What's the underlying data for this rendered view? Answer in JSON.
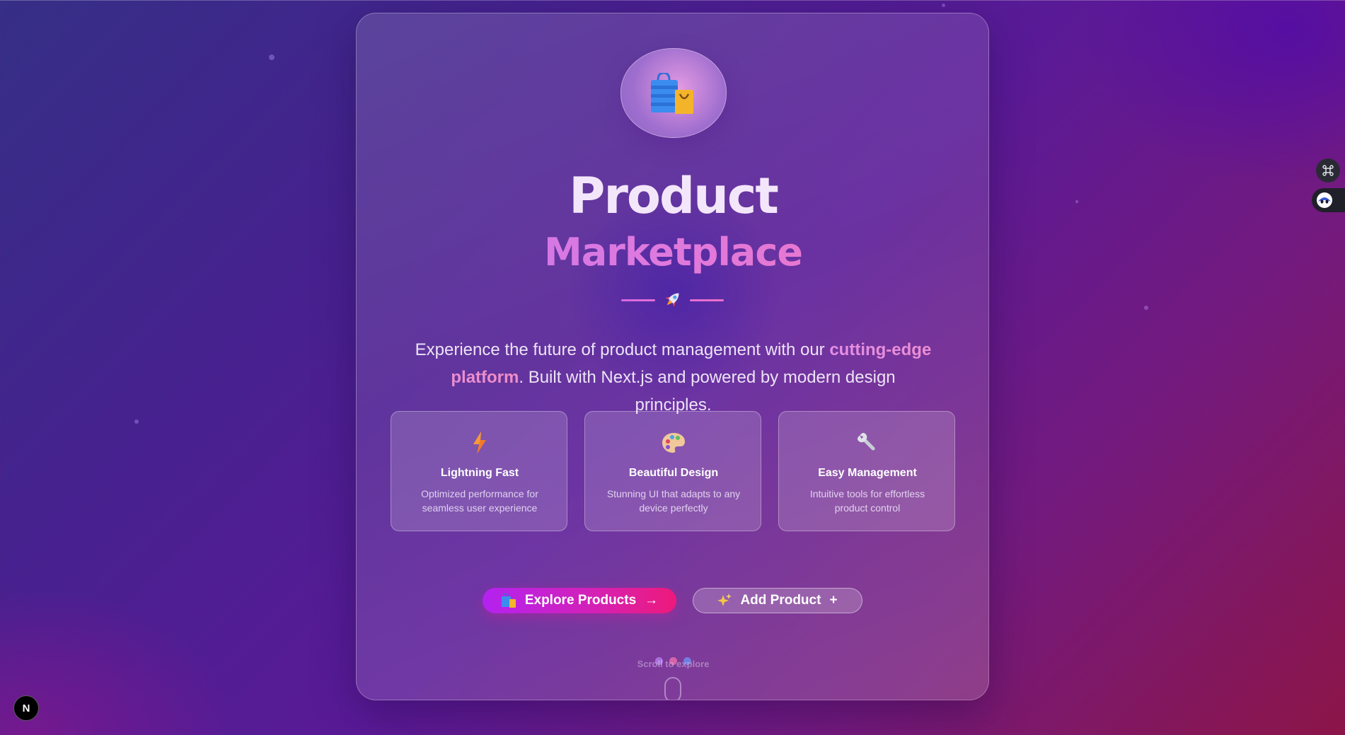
{
  "hero": {
    "title_line1": "Product",
    "title_line2": "Marketplace",
    "tagline": {
      "before": "Experience the future of product management with our ",
      "highlight": "cutting-edge platform",
      "after": ". Built with Next.js and powered by modern design principles."
    }
  },
  "features": [
    {
      "icon": "lightning-icon",
      "title": "Lightning Fast",
      "description": "Optimized performance for seamless user experience"
    },
    {
      "icon": "palette-icon",
      "title": "Beautiful Design",
      "description": "Stunning UI that adapts to any device perfectly"
    },
    {
      "icon": "wrench-icon",
      "title": "Easy Management",
      "description": "Intuitive tools for effortless product control"
    }
  ],
  "actions": {
    "explore": {
      "label": "Explore Products",
      "trailing": "→",
      "icon": "shopping-bags-icon"
    },
    "add": {
      "label": "Add Product",
      "trailing": "+",
      "icon": "sparkles-icon"
    }
  },
  "scroll_hint": "Scroll to explore",
  "next_badge": "N",
  "colors": {
    "accent_purple": "#b322f0",
    "accent_pink": "#ee1a7a",
    "title_gradient_start": "#c777ee",
    "title_gradient_end": "#f076c0"
  }
}
